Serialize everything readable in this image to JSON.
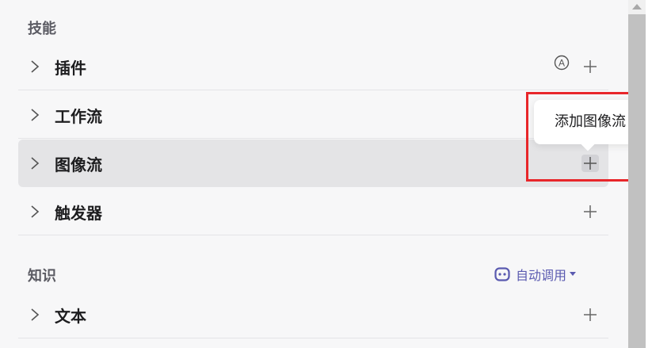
{
  "skills": {
    "title": "技能",
    "items": [
      {
        "label": "插件",
        "icon": "chevron-right-icon",
        "badge_icon": "circle-a-icon",
        "action_icon": "plus-icon"
      },
      {
        "label": "工作流",
        "icon": "chevron-right-icon",
        "action_icon": "plus-icon"
      },
      {
        "label": "图像流",
        "icon": "chevron-right-icon",
        "action_icon": "plus-icon",
        "state": "hover"
      },
      {
        "label": "触发器",
        "icon": "chevron-right-icon",
        "action_icon": "plus-icon"
      }
    ]
  },
  "tooltip": {
    "text": "添加图像流"
  },
  "knowledge": {
    "title": "知识",
    "auto_invoke": {
      "label": "自动调用",
      "icon": "robot-icon",
      "caret": "caret-down-icon"
    },
    "items": [
      {
        "label": "文本",
        "icon": "chevron-right-icon",
        "action_icon": "plus-icon"
      }
    ]
  },
  "colors": {
    "highlight_border": "#e8262a",
    "active_row": "#e4e4e6",
    "accent": "#5a5ab0"
  }
}
